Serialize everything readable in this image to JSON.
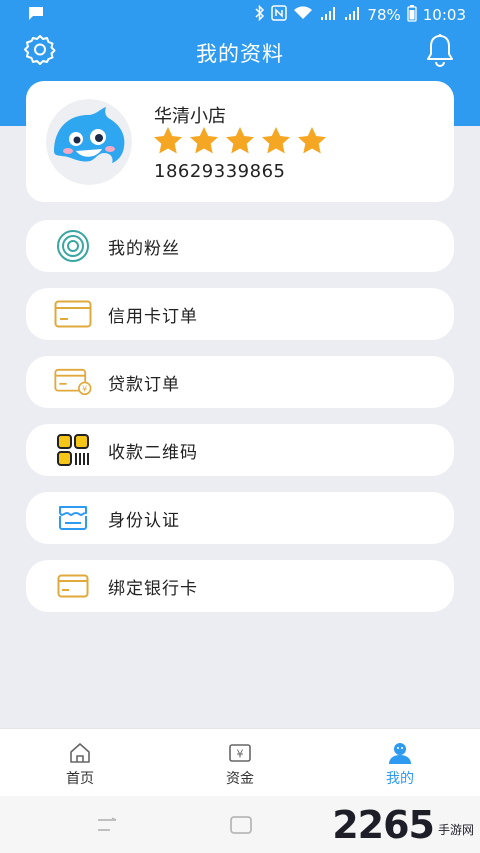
{
  "status_bar": {
    "battery": "78%",
    "time": "10:03"
  },
  "header": {
    "title": "我的资料"
  },
  "profile": {
    "shop_name": "华清小店",
    "rating": 5,
    "phone": "18629339865"
  },
  "menu": [
    {
      "label": "我的粉丝",
      "icon": "fans-icon"
    },
    {
      "label": "信用卡订单",
      "icon": "credit-card-icon"
    },
    {
      "label": "贷款订单",
      "icon": "loan-card-icon"
    },
    {
      "label": "收款二维码",
      "icon": "qr-code-icon"
    },
    {
      "label": "身份认证",
      "icon": "id-verify-icon"
    },
    {
      "label": "绑定银行卡",
      "icon": "bank-card-icon"
    }
  ],
  "tabbar": [
    {
      "label": "首页",
      "icon": "home-icon",
      "active": false
    },
    {
      "label": "资金",
      "icon": "wallet-icon",
      "active": false
    },
    {
      "label": "我的",
      "icon": "user-icon",
      "active": true
    }
  ],
  "watermark": {
    "number": "2265",
    "text": "手游网"
  },
  "colors": {
    "primary": "#2E9BF0",
    "star": "#F5A623",
    "background": "#ECECF3",
    "icon_gold": "#E0A93C",
    "icon_teal": "#3AA6A1"
  }
}
